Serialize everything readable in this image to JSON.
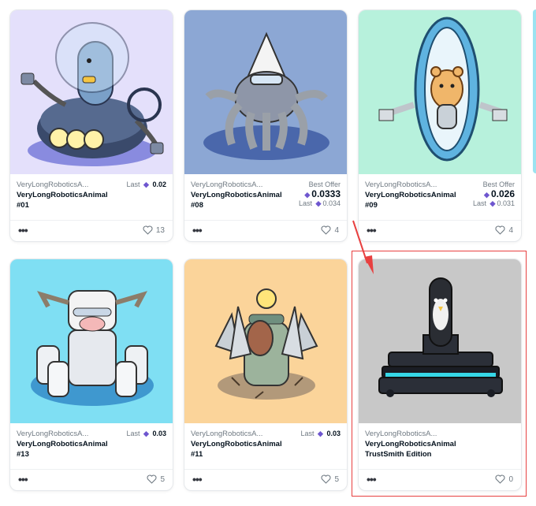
{
  "cards": [
    {
      "collection": "VeryLongRoboticsA...",
      "name": "VeryLongRoboticsAnimal",
      "token": "#01",
      "price_label": "Last",
      "price": "0.02",
      "likes": "13",
      "bg": "#e4e0fb"
    },
    {
      "collection": "VeryLongRoboticsA...",
      "name": "VeryLongRoboticsAnimal",
      "token": "#08",
      "offer_label": "Best Offer",
      "offer": "0.0333",
      "last_label": "Last",
      "last": "0.034",
      "likes": "4",
      "bg": "#8ca7d4"
    },
    {
      "collection": "VeryLongRoboticsA...",
      "name": "VeryLongRoboticsAnimal",
      "token": "#09",
      "offer_label": "Best Offer",
      "offer": "0.026",
      "last_label": "Last",
      "last": "0.031",
      "likes": "4",
      "bg": "#b7f1dc"
    },
    {
      "collection": "VeryLongRoboticsA...",
      "name": "VeryLongRoboticsAnimal",
      "token": "#13",
      "price_label": "Last",
      "price": "0.03",
      "likes": "5",
      "bg": "#7fdff3"
    },
    {
      "collection": "VeryLongRoboticsA...",
      "name": "VeryLongRoboticsAnimal",
      "token": "#11",
      "price_label": "Last",
      "price": "0.03",
      "likes": "5",
      "bg": "#fbd49a"
    },
    {
      "collection": "VeryLongRoboticsA...",
      "name": "VeryLongRoboticsAnimal",
      "token": "TrustSmith Edition",
      "likes": "0",
      "bg": "#c8c8c8"
    }
  ],
  "icons": {
    "more": "more-horizontal-icon",
    "like": "heart-outline-icon",
    "currency": "ethereum-icon"
  },
  "symbols": {
    "eth": "◆",
    "more": "•••"
  },
  "colors": {
    "accent": "#6e56cf",
    "highlight": "#e84040",
    "muted": "#707a83"
  }
}
